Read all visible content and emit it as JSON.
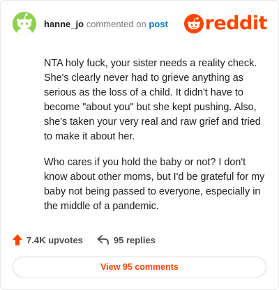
{
  "header": {
    "username": "hanne_jo",
    "action_text": "commented on",
    "link_text": "post",
    "brand": "reddit"
  },
  "comment": {
    "paragraphs": [
      "NTA holy fuck, your sister needs a reality check. She's clearly never had to grieve anything as serious as the loss of a child. It didn't have to become \"about you\" but she kept pushing. Also, she's taken your very real and raw grief and tried to make it about her.",
      "Who cares if you hold the baby or not? I don't know about other moms, but I'd be grateful for my baby not being passed to everyone, especially in the middle of a pandemic."
    ]
  },
  "stats": {
    "upvotes": "7.4K upvotes",
    "replies": "95 replies"
  },
  "footer": {
    "view_comments": "View 95 comments"
  },
  "colors": {
    "brand": "#ff4500",
    "avatar_bg": "#8fd14f",
    "link": "#0079d3"
  },
  "icons": {
    "avatar": "snoo-avatar-icon",
    "logo": "reddit-logo-icon",
    "upvote": "upvote-arrow-icon",
    "reply": "reply-arrow-icon"
  }
}
